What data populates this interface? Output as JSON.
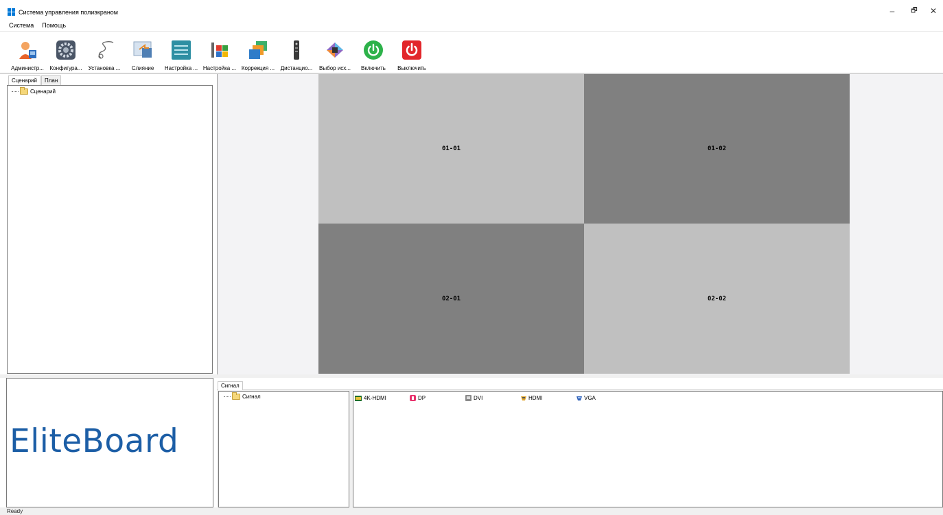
{
  "window": {
    "title": "Система управления полиэкраном",
    "minimize": "–",
    "restore": "🗗",
    "close": "✕"
  },
  "menu": [
    "Система",
    "Помощь"
  ],
  "toolbar": [
    {
      "label": "Администр...",
      "icon": "admin-user-icon"
    },
    {
      "label": "Конфигура...",
      "icon": "gear-icon"
    },
    {
      "label": "Установка ...",
      "icon": "cable-icon"
    },
    {
      "label": "Слияние",
      "icon": "merge-screen-icon"
    },
    {
      "label": "Настройка ...",
      "icon": "sliders-icon"
    },
    {
      "label": "Настройка ...",
      "icon": "color-tools-icon"
    },
    {
      "label": "Коррекция ...",
      "icon": "window-stack-icon"
    },
    {
      "label": "Дистанцио...",
      "icon": "remote-control-icon"
    },
    {
      "label": "Выбор исх...",
      "icon": "source-select-icon"
    },
    {
      "label": "Включить",
      "icon": "power-on-icon"
    },
    {
      "label": "Выключить",
      "icon": "power-off-icon"
    }
  ],
  "left_tabs": [
    "Сценарий",
    "План"
  ],
  "scenario_tree": {
    "root": "Сценарий"
  },
  "screens": [
    "01-01",
    "01-02",
    "02-01",
    "02-02"
  ],
  "logo": "EliteBoard",
  "signal_tab": "Сигнал",
  "signal_tree": {
    "root": "Сигнал"
  },
  "signals": [
    {
      "label": "4K-HDMI",
      "icon": "4k-hdmi-icon"
    },
    {
      "label": "DP",
      "icon": "dp-icon"
    },
    {
      "label": "DVI",
      "icon": "dvi-icon"
    },
    {
      "label": "HDMI",
      "icon": "hdmi-icon"
    },
    {
      "label": "VGA",
      "icon": "vga-icon"
    }
  ],
  "status": "Ready",
  "colors": {
    "accent": "#0078d7",
    "logo_blue": "#1c5ea6",
    "screen_light": "#c0c0c0",
    "screen_dark": "#808080",
    "power_on": "#2db24a",
    "power_off": "#e2262b"
  }
}
